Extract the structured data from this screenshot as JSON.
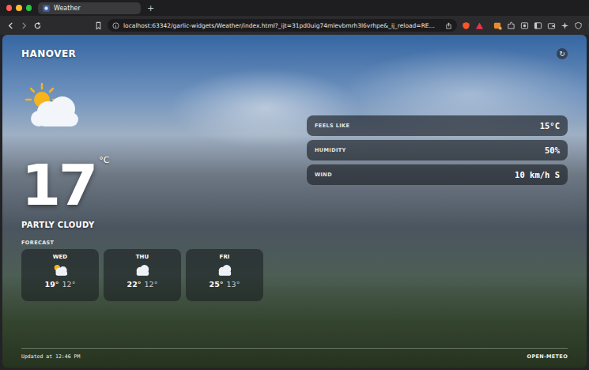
{
  "browser": {
    "tab": {
      "title": "Weather",
      "selected": true
    },
    "new_tab": "+",
    "url": "localhost:63342/garlic-widgets/Weather/index.html?_ijt=31pd0uig74mlevbmrh3l6vrhpe&_ij_reload=RE…"
  },
  "weather": {
    "city": "HANOVER",
    "refresh": "↻",
    "temperature": "17",
    "unit": "°C",
    "condition": "PARTLY CLOUDY",
    "forecast_label": "FORECAST",
    "forecast": [
      {
        "day": "WED",
        "high": "19°",
        "low": "12°",
        "kind": "partly-cloudy"
      },
      {
        "day": "THU",
        "high": "22°",
        "low": "12°",
        "kind": "cloudy"
      },
      {
        "day": "FRI",
        "high": "25°",
        "low": "13°",
        "kind": "cloudy"
      }
    ],
    "details": [
      {
        "label": "FEELS LIKE",
        "value": "15°C"
      },
      {
        "label": "HUMIDITY",
        "value": "50%"
      },
      {
        "label": "WIND",
        "value": "10 km/h S"
      }
    ],
    "footer": {
      "updated": "Updated at 12:46 PM",
      "source": "OPEN-METEO"
    }
  }
}
